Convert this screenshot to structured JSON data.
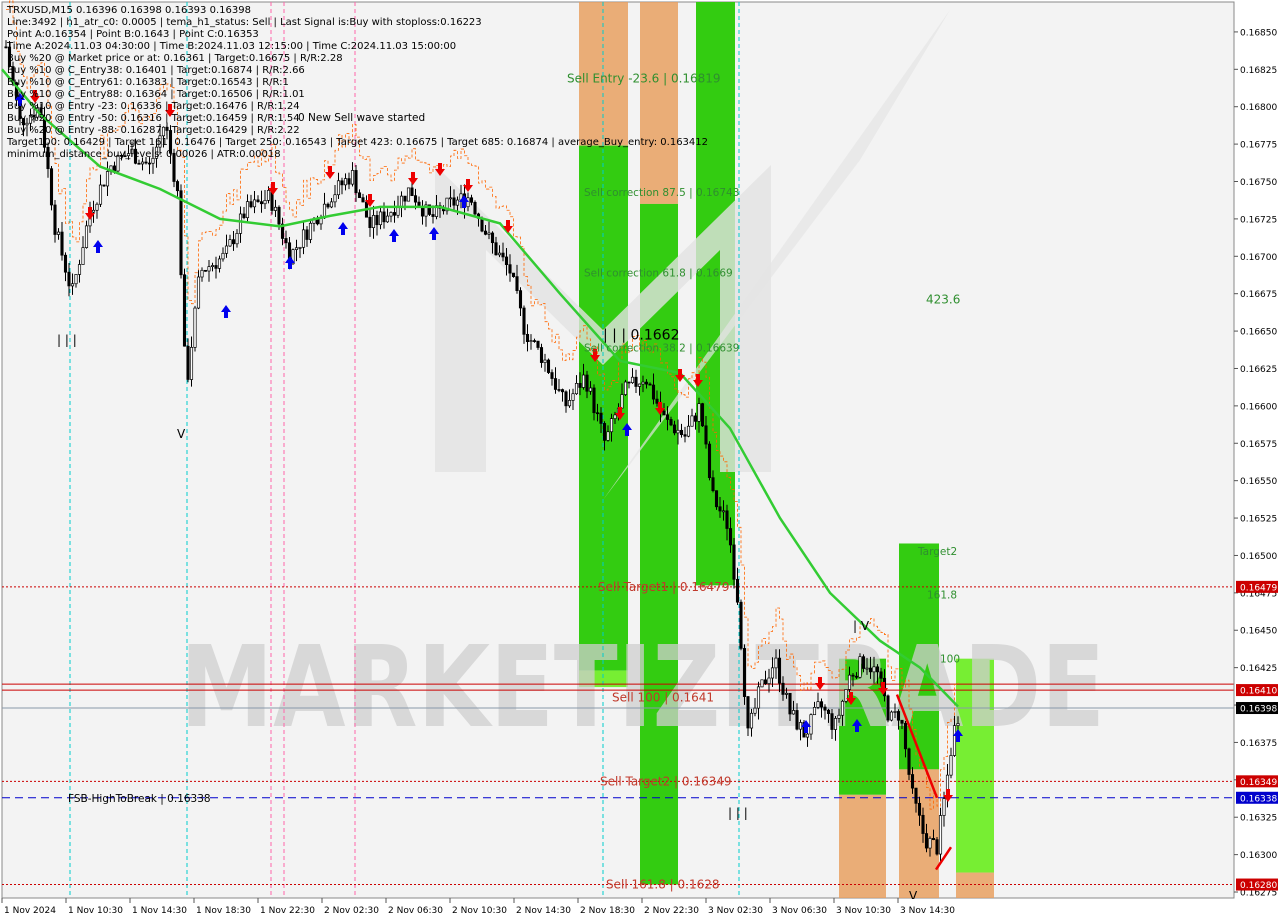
{
  "colors": {
    "background": "#ffffff",
    "chart_bg": "#f3f3f3",
    "candle": "#000000",
    "ma_line": "#33cc33",
    "stop_line": "#ff6600",
    "zone_green": "#33cc11",
    "zone_orange": "#e8a060",
    "zone_light_green": "#77ee33",
    "level_red": "#cc0000",
    "level_blue": "#0000cc",
    "label_green_text": "#2f8f2f",
    "label_red_text": "#c0392b",
    "cyan_line": "#00cccc",
    "magenta_line": "#ff66aa",
    "watermark": "#cfcfcf",
    "current_price_bg": "#000000",
    "blue_arrow": "#0000ee",
    "red_arrow": "#ee0000"
  },
  "info_lines": [
    "TRXUSD,M15  0.16396 0.16398 0.16393 0.16398",
    "Line:3492 | h1_atr_c0: 0.0005 | tema_h1_status: Sell | Last Signal is:Buy with stoploss:0.16223",
    "Point A:0.16354 | Point B:0.1643 | Point C:0.16353",
    "Time A:2024.11.03 04:30:00 | Time B:2024.11.03 12:15:00 | Time C:2024.11.03 15:00:00",
    "Buy %20 @ Market price or at: 0.16361 | Target:0.16675 | R/R:2.28",
    "Buy %10 @ C_Entry38: 0.16401 | Target:0.16874 | R/R:2.66",
    "Buy %10 @ C_Entry61: 0.16383 | Target:0.16543 | R/R:1",
    "Buy %10 @ C_Entry88: 0.16364 | Target:0.16506 | R/R:1.01",
    "Buy %10 @ Entry -23: 0.16336 | Target:0.16476 | R/R:1.24",
    "Buy %20 @ Entry -50: 0.16316 | Target:0.16459 | R/R:1.54",
    "Buy %20 @ Entry -88: 0.16287 | Target:0.16429 | R/R:2.22",
    "Target100: 0.16429 | Target 161: 0.16476 | Target 250: 0.16543 | Target 423: 0.16675 | Target 685: 0.16874 | average_Buy_entry: 0.163412",
    "minimum_distance_buy_levels: 0.00026 | ATR:0.00018"
  ],
  "chart_data": {
    "type": "candlestick",
    "symbol": "TRXUSD",
    "timeframe": "M15",
    "ylim": [
      0.16271,
      0.1687
    ],
    "y_ticks": [
      "0.16850",
      "0.16825",
      "0.16800",
      "0.16775",
      "0.16750",
      "0.16725",
      "0.16700",
      "0.16675",
      "0.16650",
      "0.16625",
      "0.16600",
      "0.16575",
      "0.16550",
      "0.16525",
      "0.16500",
      "0.16475",
      "0.16450",
      "0.16425",
      "0.16400",
      "0.16375",
      "0.16350",
      "0.16325",
      "0.16300",
      "0.16275"
    ],
    "x_ticks": [
      "1 Nov 2024",
      "1 Nov 10:30",
      "1 Nov 14:30",
      "1 Nov 18:30",
      "1 Nov 22:30",
      "2 Nov 02:30",
      "2 Nov 06:30",
      "2 Nov 10:30",
      "2 Nov 14:30",
      "2 Nov 18:30",
      "2 Nov 22:30",
      "3 Nov 02:30",
      "3 Nov 06:30",
      "3 Nov 10:30",
      "3 Nov 14:30"
    ],
    "price_tags": [
      {
        "label": "0.16479",
        "value": 0.16479,
        "style": "red"
      },
      {
        "label": "0.16410",
        "value": 0.1641,
        "style": "red"
      },
      {
        "label": "0.16398",
        "value": 0.16398,
        "style": "current"
      },
      {
        "label": "0.16349",
        "value": 0.16349,
        "style": "red"
      },
      {
        "label": "0.16338",
        "value": 0.16338,
        "style": "blue"
      },
      {
        "label": "0.16280",
        "value": 0.1628,
        "style": "red"
      }
    ],
    "horizontal_levels": [
      {
        "value": 0.16479,
        "style": "red-dotted"
      },
      {
        "value": 0.16414,
        "style": "red-solid"
      },
      {
        "value": 0.1641,
        "style": "red-solid"
      },
      {
        "value": 0.16398,
        "style": "grey-solid"
      },
      {
        "value": 0.16349,
        "style": "red-dotted"
      },
      {
        "value": 0.16338,
        "style": "blue-dashed"
      },
      {
        "value": 0.1628,
        "style": "red-dotted"
      }
    ],
    "annotations": [
      {
        "text": "Sell Entry -23.6 | 0.16819",
        "price": 0.16819,
        "color": "green"
      },
      {
        "text": "Sell correction 87.5 | 0.16743",
        "price": 0.16743,
        "color": "green"
      },
      {
        "text": "Sell correction 61.8 | 0.1669",
        "price": 0.16689,
        "color": "green"
      },
      {
        "text": "Sell correction 38.2 | 0.16639",
        "price": 0.16639,
        "color": "green"
      },
      {
        "text": "| | | 0.1662",
        "price": 0.16647,
        "color": "black"
      },
      {
        "text": "Sell Target1 | 0.16479",
        "price": 0.16479,
        "color": "red"
      },
      {
        "text": "Sell 100 | 0.1641",
        "price": 0.16405,
        "color": "red"
      },
      {
        "text": "Sell Target2 | 0.16349",
        "price": 0.16349,
        "color": "red"
      },
      {
        "text": "Sell 161.8 | 0.1628",
        "price": 0.1628,
        "color": "red"
      },
      {
        "text": "0 New Sell wave started",
        "price": 0.16793,
        "color": "black"
      },
      {
        "text": "FSB-HighToBreak | 0.16338",
        "price": 0.16338,
        "color": "black"
      },
      {
        "text": "423.6",
        "price": 0.16671,
        "color": "green"
      },
      {
        "text": "Target2",
        "price": 0.16503,
        "color": "green"
      },
      {
        "text": "161.8",
        "price": 0.16474,
        "color": "green"
      },
      {
        "text": "100",
        "price": 0.16431,
        "color": "green"
      }
    ],
    "watermark": "MARKETIZITRADE"
  }
}
